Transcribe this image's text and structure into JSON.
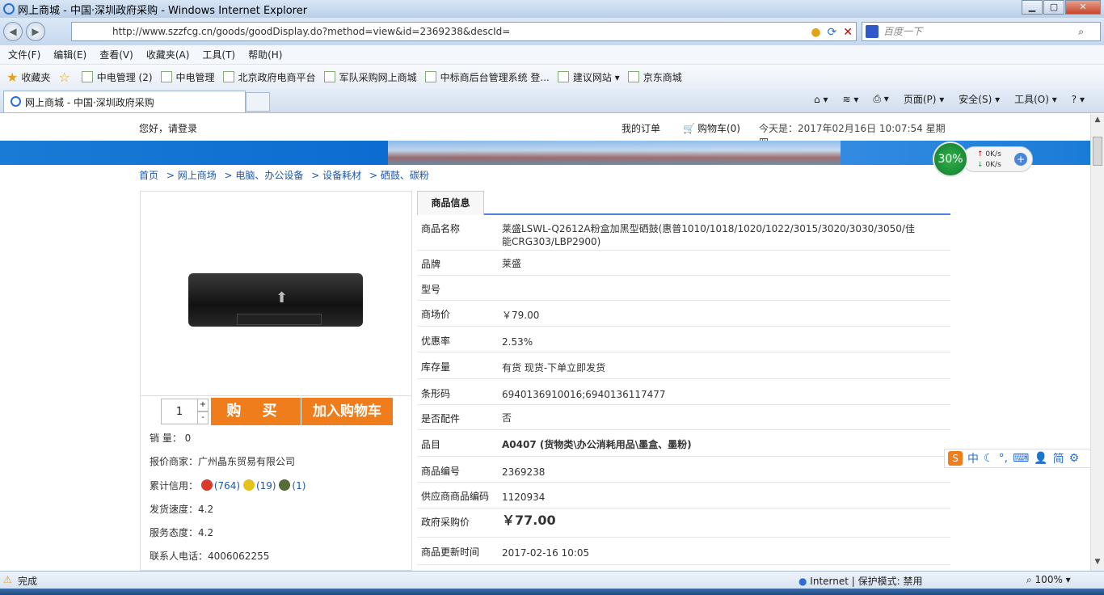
{
  "window": {
    "title": "网上商城 - 中国·深圳政府采购 - Windows Internet Explorer"
  },
  "address": {
    "url": "http://www.szzfcg.cn/goods/goodDisplay.do?method=view&id=2369238&descId=",
    "search_placeholder": "百度一下"
  },
  "menu": [
    "文件(F)",
    "编辑(E)",
    "查看(V)",
    "收藏夹(A)",
    "工具(T)",
    "帮助(H)"
  ],
  "favorites": {
    "label": "收藏夹",
    "items": [
      "中电管理 (2)",
      "中电管理",
      "北京政府电商平台",
      "军队采购网上商城",
      "中标商后台管理系统  登...",
      "建议网站 ▾",
      "京东商城"
    ]
  },
  "tab": {
    "label": "网上商城 - 中国·深圳政府采购"
  },
  "commandbar": [
    "页面(P) ▾",
    "安全(S) ▾",
    "工具(O) ▾",
    "? ▾"
  ],
  "header": {
    "greeting": "您好，请登录",
    "my_orders": "我的订单",
    "cart": "购物车(0)",
    "today": "今天是：2017年02月16日  10:07:54 星期四"
  },
  "netwidget": {
    "percent": "30%",
    "up": "0K/s",
    "down": "0K/s"
  },
  "breadcrumbs": [
    "首页",
    "> 网上商场",
    "> 电脑、办公设备",
    "> 设备耗材",
    "> 硒鼓、碳粉"
  ],
  "product": {
    "qty": "1",
    "buy_label": "购 买",
    "add_cart_label": "加入购物车",
    "sales": "销    量：  0",
    "quote_vendor": "报价商家：广州晶东贸易有限公司",
    "credit_label": "累计信用：",
    "credit_1": "(764)",
    "credit_2": "(19)",
    "credit_3": "(1)",
    "ship_speed": "发货速度：4.2",
    "service": "服务态度：4.2",
    "phone": "联系人电话：4006062255"
  },
  "info_tab": "商品信息",
  "info": [
    {
      "k": "商品名称",
      "v": "莱盛LSWL-Q2612A粉盒加黑型硒鼓(惠普1010/1018/1020/1022/3015/3020/3030/3050/佳能CRG303/LBP2900)"
    },
    {
      "k": "品牌",
      "v": "莱盛"
    },
    {
      "k": "型号",
      "v": ""
    },
    {
      "k": "商场价",
      "v": "￥79.00"
    },
    {
      "k": "优惠率",
      "v": "2.53%"
    },
    {
      "k": "库存量",
      "v": "有货  现货-下单立即发货"
    },
    {
      "k": "条形码",
      "v": "6940136910016;6940136117477"
    },
    {
      "k": "是否配件",
      "v": "否"
    },
    {
      "k": "品目",
      "v": "A0407  (货物类\\办公消耗用品\\墨盒、墨粉)"
    },
    {
      "k": "商品编号",
      "v": "2369238"
    },
    {
      "k": "供应商商品编码",
      "v": "1120934"
    },
    {
      "k": "政府采购价",
      "v": "￥77.00"
    },
    {
      "k": "商品更新时间",
      "v": "2017-02-16 10:05"
    }
  ],
  "ime": [
    "中",
    "简"
  ],
  "status": {
    "done": "完成",
    "zone": "Internet | 保护模式: 禁用",
    "zoom": "100%"
  }
}
